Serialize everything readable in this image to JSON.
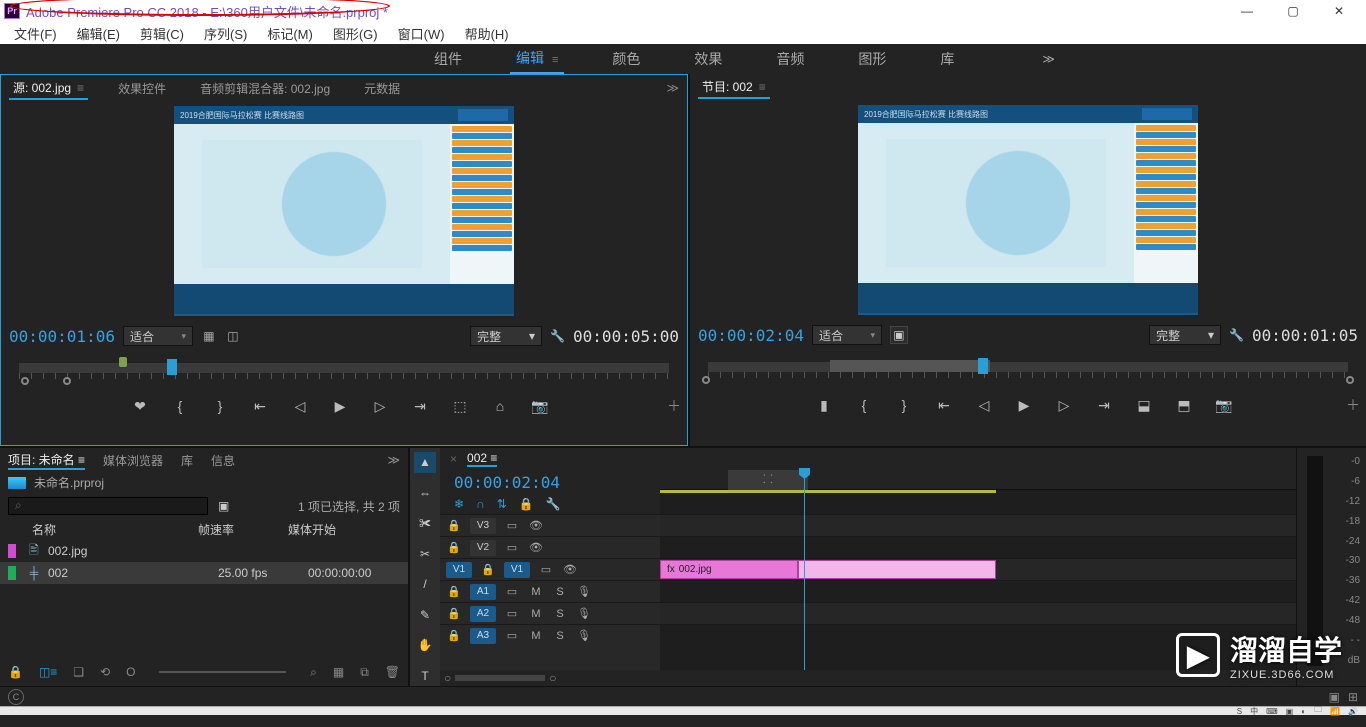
{
  "app": {
    "icon_text": "Pr",
    "title": "Adobe Premiere Pro CC 2018 - E:\\360用户文件\\未命名.prproj *"
  },
  "win_btns": {
    "min": "—",
    "max": "▢",
    "close": "✕"
  },
  "menus": [
    "文件(F)",
    "编辑(E)",
    "剪辑(C)",
    "序列(S)",
    "标记(M)",
    "图形(G)",
    "窗口(W)",
    "帮助(H)"
  ],
  "workspaces": {
    "items": [
      "组件",
      "编辑",
      "颜色",
      "效果",
      "音频",
      "图形",
      "库"
    ],
    "active_index": 1,
    "more": "≫"
  },
  "source": {
    "tabs": [
      "源: 002.jpg",
      "效果控件",
      "音频剪辑混合器: 002.jpg",
      "元数据"
    ],
    "active_index": 0,
    "tc_in": "00:00:01:06",
    "tc_dur": "00:00:05:00",
    "zoom_label": "适合",
    "quality_label": "完整",
    "thumb_header": "2019合肥国际马拉松赛   比赛线路图"
  },
  "program": {
    "tab": "节目: 002",
    "tc_in": "00:00:02:04",
    "tc_dur": "00:00:01:05",
    "zoom_label": "适合",
    "quality_label": "完整",
    "thumb_header": "2019合肥国际马拉松赛   比赛线路图"
  },
  "transport_icons": [
    "❤",
    "{",
    "}",
    "⇤",
    "◁",
    "▶",
    "▷",
    "⇥",
    "⬚",
    "⌂",
    "⌧",
    "📷"
  ],
  "project": {
    "tabs": [
      "项目: 未命名",
      "媒体浏览器",
      "库",
      "信息"
    ],
    "active_index": 0,
    "proj_name": "未命名.prproj",
    "search_placeholder": "⌕",
    "selection_info": "1 项已选择, 共 2 项",
    "columns": [
      "名称",
      "帧速率",
      "媒体开始"
    ],
    "rows": [
      {
        "chip": "#d04dd0",
        "icon": "🖹",
        "name": "002.jpg",
        "fps": "",
        "start": ""
      },
      {
        "chip": "#1fae57",
        "icon": "╪",
        "name": "002",
        "fps": "25.00 fps",
        "start": "00:00:00:00",
        "selected": true
      }
    ],
    "footer_icons": [
      "🔒",
      "◫≡",
      "❏",
      "⟲",
      "O"
    ],
    "footer_right": [
      "⌕",
      "▦",
      "⧉",
      "🗑"
    ]
  },
  "tools": [
    "▲",
    "⇔",
    "✀",
    "✎",
    "/",
    "✋",
    "T"
  ],
  "timeline": {
    "name": "002",
    "tc": "00:00:02:04",
    "mini_btns": [
      "❄",
      "∩",
      "⇅",
      "🔒",
      "🔧"
    ],
    "video_tracks": [
      "V3",
      "V2",
      "V1"
    ],
    "audio_tracks": [
      "A1",
      "A2",
      "A3"
    ],
    "clip_name": "002.jpg",
    "mute": "M",
    "solo": "S",
    "mic": "🎙"
  },
  "meter": {
    "labels": [
      "-0",
      "-6",
      "-12",
      "-18",
      "-24",
      "-30",
      "-36",
      "-42",
      "-48",
      "- -",
      "dB"
    ]
  },
  "watermark": {
    "brand": "溜溜自学",
    "url": "ZIXUE.3D66.COM"
  },
  "taskbar_items": [
    "S",
    "中",
    "⌨",
    "▣",
    "◐",
    "🗀",
    "📶",
    "🔊"
  ]
}
